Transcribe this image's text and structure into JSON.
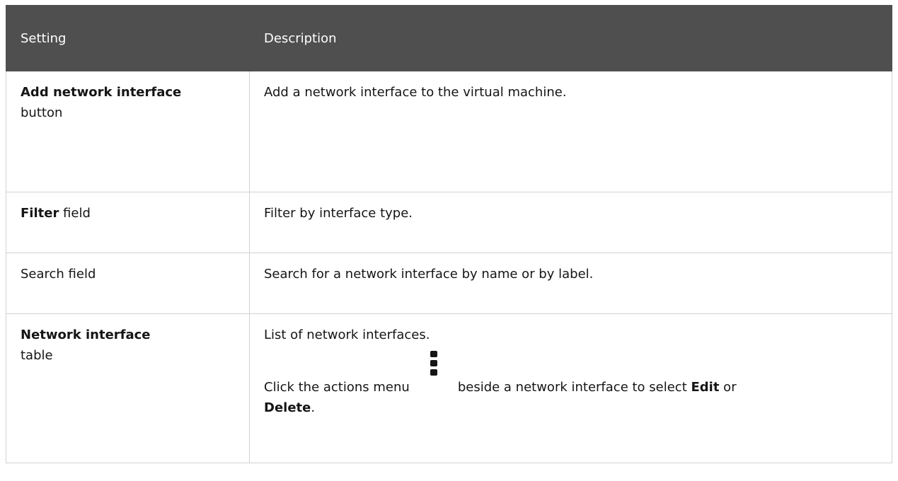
{
  "header": {
    "setting": "Setting",
    "description": "Description"
  },
  "rows": [
    {
      "setting_strong": "Add network interface",
      "setting_rest": "button",
      "description": "Add a network interface to the virtual machine."
    },
    {
      "setting_strong": "Filter",
      "setting_rest": " field",
      "description": "Filter by interface type."
    },
    {
      "setting_strong": "",
      "setting_rest": "Search field",
      "description": "Search for a network interface by name or by label."
    },
    {
      "setting_strong": "Network interface",
      "setting_rest": "table",
      "description": "List of network interfaces.",
      "description2_prefix": "Click the actions menu",
      "description2_mid": "beside a network interface to select ",
      "edit": "Edit",
      "or": " or",
      "delete": "Delete",
      "end": "."
    }
  ],
  "icons": {
    "actions_menu": "kebab-icon"
  }
}
